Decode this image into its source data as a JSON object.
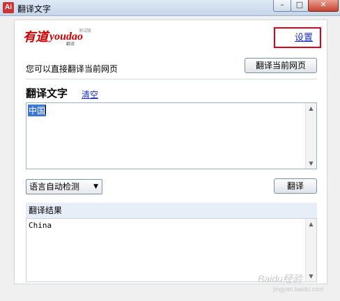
{
  "window": {
    "title": "翻译文字",
    "app_icon_text": "Ai",
    "controls": {
      "minimize": "–",
      "maximize": "□",
      "close": "✕"
    }
  },
  "logo": {
    "brand_cn": "有道",
    "brand_en": "youdao",
    "tag": "测试版",
    "sub": "翻译"
  },
  "settings": {
    "label": "设置"
  },
  "hint": {
    "text": "您可以直接翻译当前网页"
  },
  "buttons": {
    "translate_page": "翻译当前网页",
    "translate": "翻译"
  },
  "input_section": {
    "title": "翻译文字",
    "clear_label": "清空",
    "value": "中国"
  },
  "language_select": {
    "selected": "语言自动检测"
  },
  "result": {
    "header": "翻译结果",
    "value": "China"
  },
  "watermark": {
    "text": "Baidu经验",
    "sub": "jingyan.baidu.com"
  },
  "colors": {
    "link": "#1a2fcc",
    "highlight_box": "#e0001a",
    "selection": "#3b78d3",
    "brand_red": "#cc0000"
  }
}
